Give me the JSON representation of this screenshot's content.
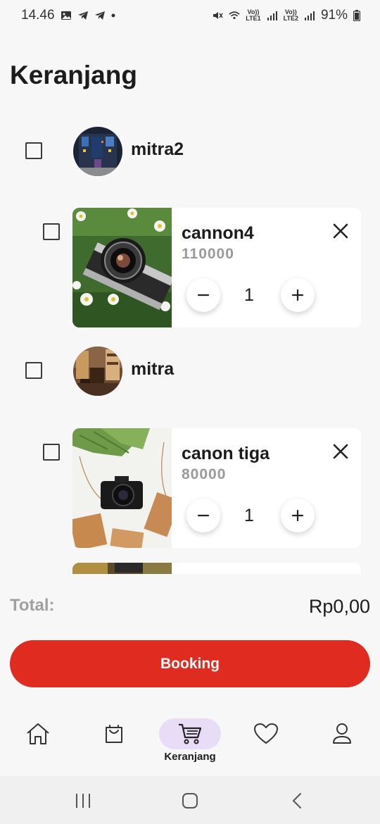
{
  "status_bar": {
    "time": "14.46",
    "lte1": "LTE1",
    "lte2": "LTE2",
    "volte": "Vo))",
    "battery": "91%"
  },
  "page": {
    "title": "Keranjang"
  },
  "shops": [
    {
      "name": "mitra2",
      "items": [
        {
          "name": "cannon4",
          "price": "110000",
          "quantity": "1"
        }
      ]
    },
    {
      "name": "mitra",
      "items": [
        {
          "name": "canon tiga",
          "price": "80000",
          "quantity": "1"
        }
      ]
    }
  ],
  "summary": {
    "total_label": "Total:",
    "total_value": "Rp0,00"
  },
  "actions": {
    "booking_label": "Booking"
  },
  "bottom_nav": {
    "items": [
      {
        "icon": "home-icon",
        "label": ""
      },
      {
        "icon": "shopping-bag-icon",
        "label": ""
      },
      {
        "icon": "cart-icon",
        "label": "Keranjang",
        "active": true
      },
      {
        "icon": "heart-icon",
        "label": ""
      },
      {
        "icon": "profile-icon",
        "label": ""
      }
    ]
  },
  "colors": {
    "accent": "#df2b20",
    "active_nav_bg": "#e9dcf7",
    "background": "#f7f7f7",
    "price_gray": "#9a9a9a"
  }
}
